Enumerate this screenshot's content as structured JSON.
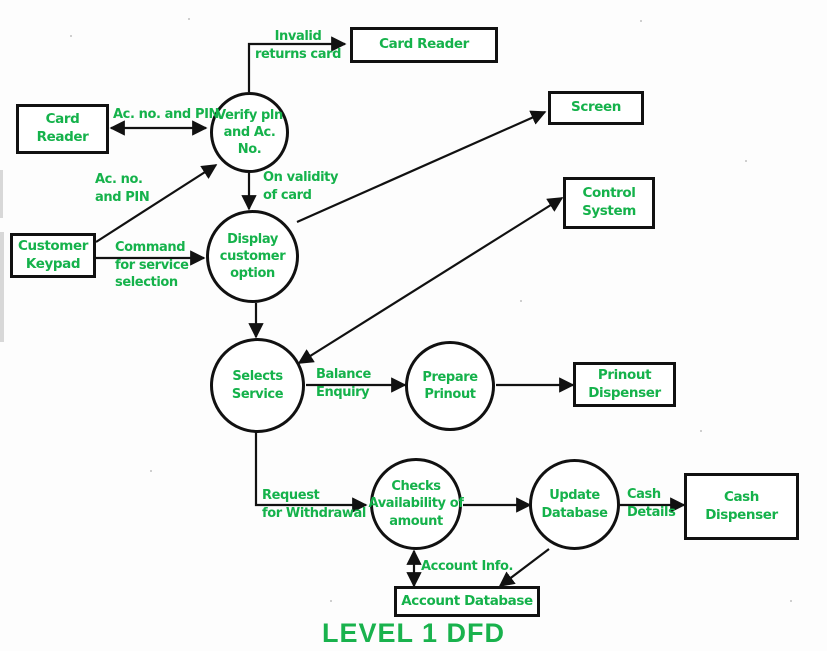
{
  "diagram": {
    "title": "LEVEL 1 DFD",
    "type": "data-flow-diagram",
    "accent_color": "#15b24b",
    "line_color": "#111111",
    "background_color": "#ffffff",
    "external_entities": [
      {
        "id": "card-reader-left",
        "label_line1": "Card",
        "label_line2": "Reader"
      },
      {
        "id": "card-reader-top",
        "label_line1": "Card Reader",
        "label_line2": ""
      },
      {
        "id": "screen",
        "label_line1": "Screen",
        "label_line2": ""
      },
      {
        "id": "control-system",
        "label_line1": "Control",
        "label_line2": "System"
      },
      {
        "id": "customer-keypad",
        "label_line1": "Customer",
        "label_line2": "Keypad"
      },
      {
        "id": "prinout-dispenser",
        "label_line1": "Prinout",
        "label_line2": "Dispenser"
      },
      {
        "id": "cash-dispenser",
        "label_line1": "Cash",
        "label_line2": "Dispenser"
      },
      {
        "id": "account-database",
        "label_line1": "Account Database",
        "label_line2": ""
      }
    ],
    "processes": [
      {
        "id": "verify-pin",
        "line1": "Verify pln",
        "line2": "and Ac.",
        "line3": "No."
      },
      {
        "id": "display-customer-option",
        "line1": "Display",
        "line2": "customer",
        "line3": "option"
      },
      {
        "id": "selects-service",
        "line1": "Selects",
        "line2": "Service",
        "line3": ""
      },
      {
        "id": "prepare-prinout",
        "line1": "Prepare",
        "line2": "Prinout",
        "line3": ""
      },
      {
        "id": "checks-availability",
        "line1": "Checks",
        "line2": "Availability of",
        "line3": "amount"
      },
      {
        "id": "update-database",
        "line1": "Update",
        "line2": "Database",
        "line3": ""
      }
    ],
    "flows": [
      {
        "id": "invalid-returns-card",
        "line1": "Invalid",
        "line2": "returns card"
      },
      {
        "id": "ac-no-and-pin-reader",
        "line1": "Ac. no. and PIN",
        "line2": ""
      },
      {
        "id": "ac-no-and-pin-keypad",
        "line1": "Ac. no.",
        "line2": "and PIN"
      },
      {
        "id": "on-validity-of-card",
        "line1": "On validity",
        "line2": "of card"
      },
      {
        "id": "command-for-service-selection",
        "line1": "Command",
        "line2": "for service",
        "line3": "selection"
      },
      {
        "id": "balance-enquiry",
        "line1": "Balance",
        "line2": "Enquiry"
      },
      {
        "id": "request-for-withdrawal",
        "line1": "Request",
        "line2": "for Withdrawal"
      },
      {
        "id": "account-info",
        "line1": "Account Info.",
        "line2": ""
      },
      {
        "id": "cash-details",
        "line1": "Cash",
        "line2": "Details"
      }
    ]
  }
}
